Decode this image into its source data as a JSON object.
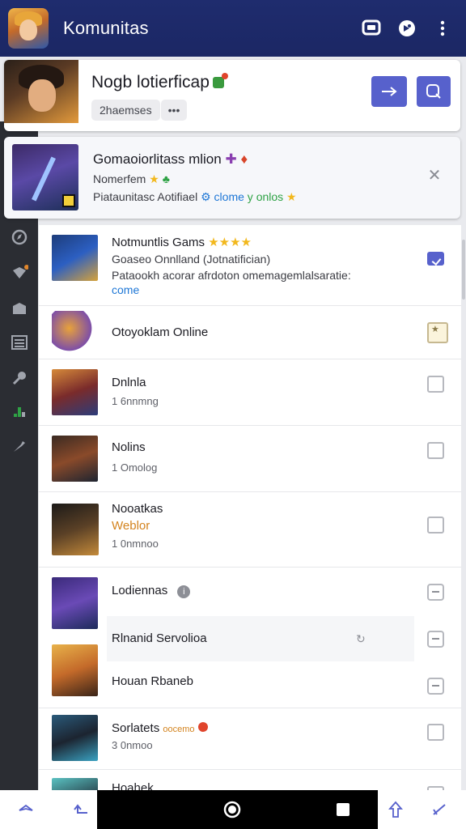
{
  "app": {
    "title": "Komunitas",
    "colors": {
      "topbar": "#1f2c6e",
      "accent": "#5761cc",
      "rail": "#2b2d33"
    }
  },
  "header_icons": [
    "chat-icon",
    "discord-icon",
    "more-vert-icon"
  ],
  "featured_card": {
    "title": "Nogb lotierficap",
    "chip_label": "2haemses",
    "more_label": "•••"
  },
  "promo_card": {
    "title": "Gomaoiorlitass mlion",
    "subtitle": "Nomerfem",
    "description_prefix": "Piataunitasc Aotifiael",
    "description_link": "clome",
    "description_mid": "y",
    "description_suffix": "onlos"
  },
  "list": {
    "items": [
      {
        "name": "Notmuntlis Gams",
        "stars": "★★★★",
        "line2": "Goaseo Onnlland (Jotnatifician)",
        "line3": "Pataookh acorar afrdoton omemagemlalsaratie:",
        "link": "come",
        "checked": true
      },
      {
        "name": "Otoyoklam Online"
      },
      {
        "name": "Dnlnla",
        "sub": "1 6nnmng"
      },
      {
        "name": "Nolins",
        "sub": "1 Omolog"
      },
      {
        "name": "Nooatkas",
        "accent": "Weblor",
        "sub": "1 0nmnoo"
      },
      {
        "name": "Lodiennas"
      },
      {
        "name": "Rlnanid Servolioa"
      },
      {
        "name": "Houan Rbaneb"
      },
      {
        "name": "Sorlatets",
        "tag": "oocemo",
        "sub": "3 0nmoo"
      },
      {
        "name": "Hoahek"
      }
    ]
  }
}
